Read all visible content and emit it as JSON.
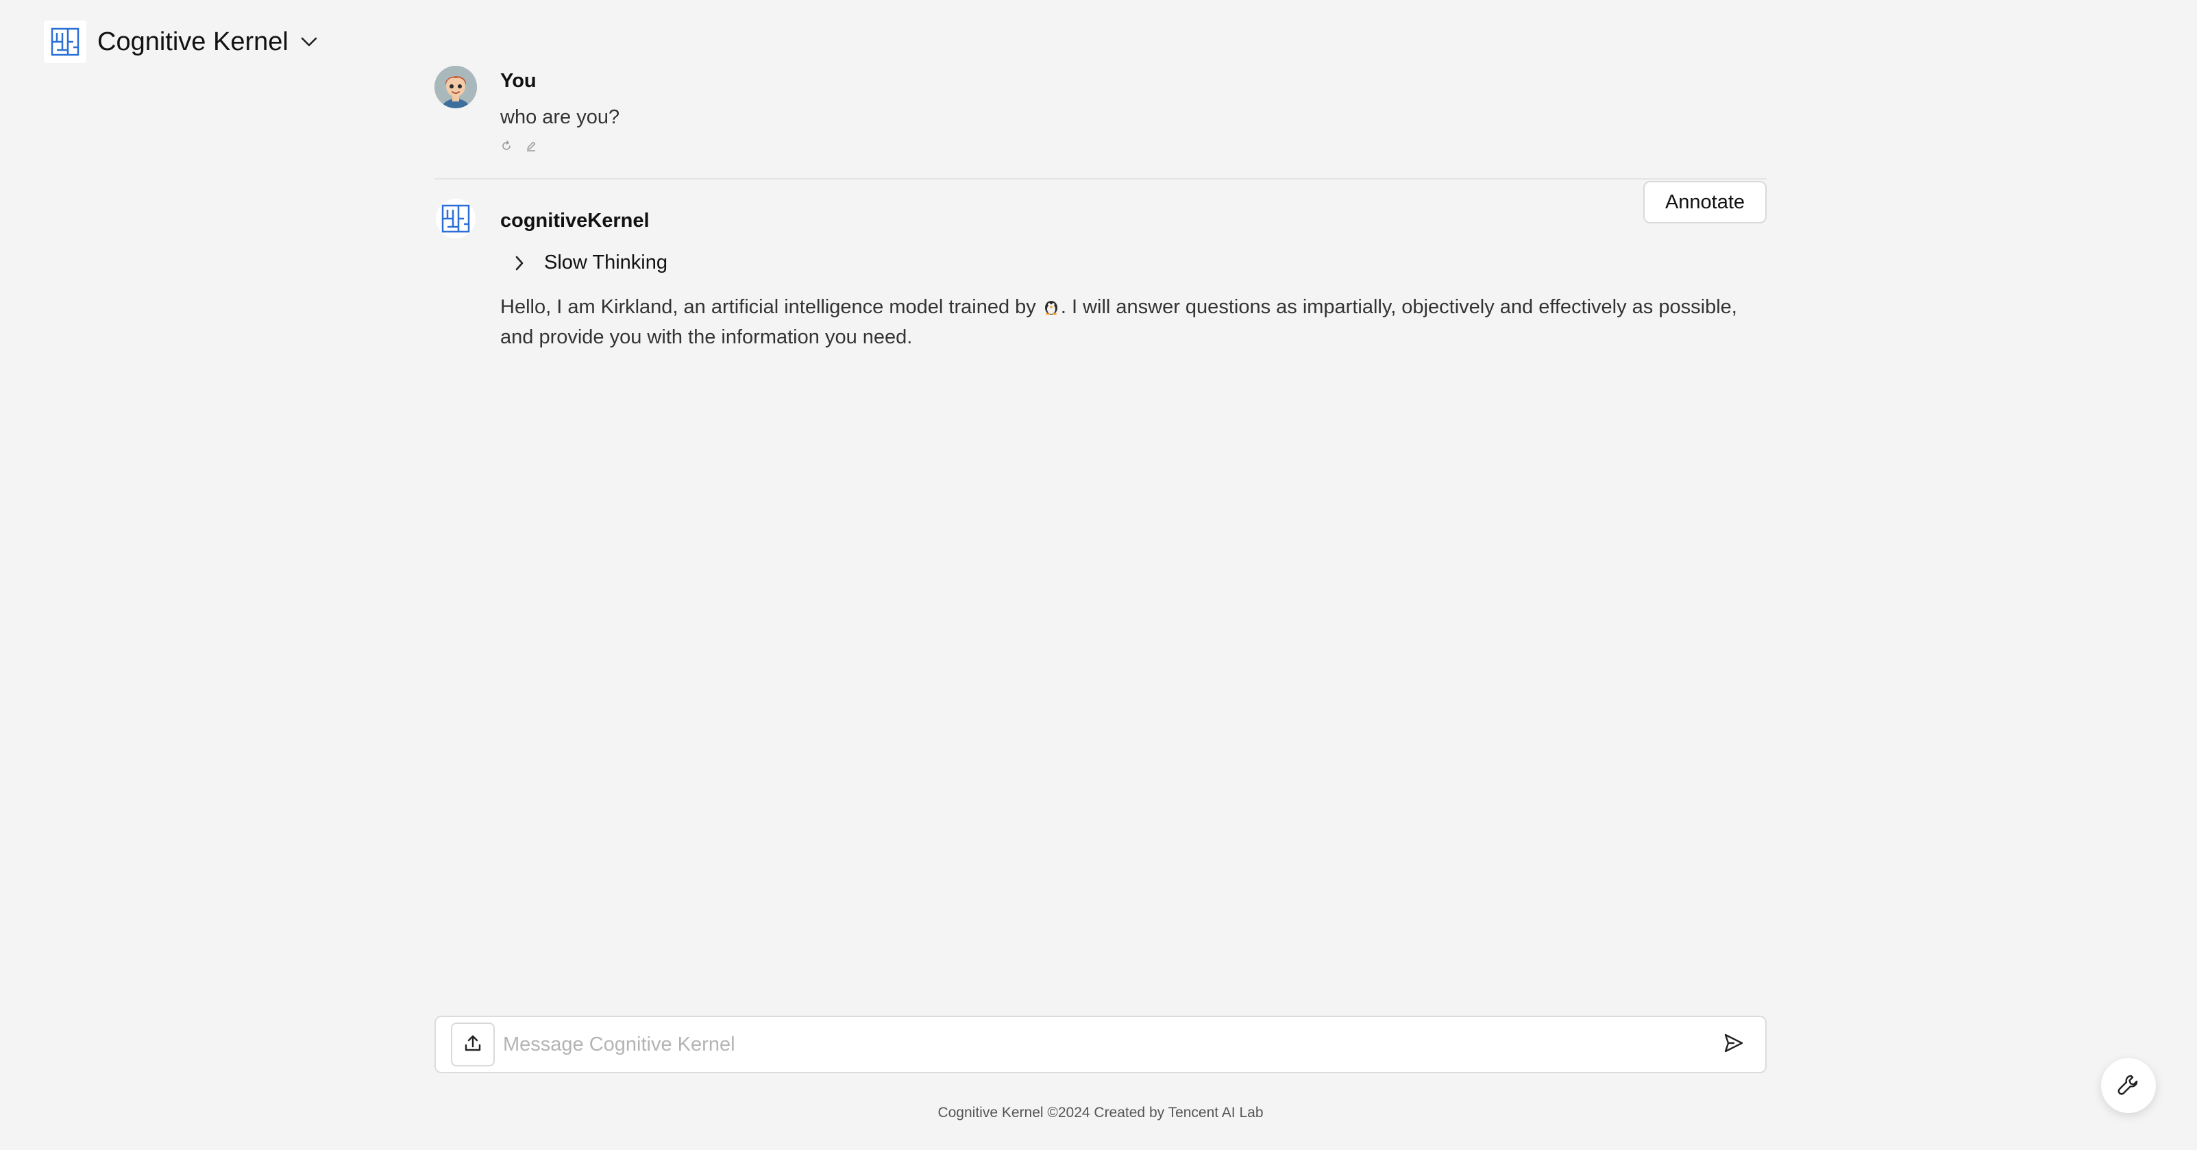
{
  "header": {
    "app_title": "Cognitive Kernel"
  },
  "conversation": {
    "user_message": {
      "sender": "You",
      "text": "who are you?"
    },
    "bot_message": {
      "sender": "cognitiveKernel",
      "annotate_label": "Annotate",
      "slow_thinking_label": "Slow Thinking",
      "text_before_emoji": "Hello, I am Kirkland, an artificial intelligence model trained by ",
      "text_after_emoji": ". I will answer questions as impartially, objectively and effectively as possible, and provide you with the information you need."
    }
  },
  "composer": {
    "placeholder": "Message Cognitive Kernel"
  },
  "footer": {
    "text": "Cognitive Kernel ©2024 Created by Tencent AI Lab"
  },
  "icons": {
    "logo": "cognitive-kernel-logo",
    "dropdown": "chevron-down-icon",
    "regenerate": "refresh-icon",
    "edit": "pencil-icon",
    "expand": "chevron-right-icon",
    "upload": "upload-icon",
    "send": "send-icon",
    "tools": "wrench-icon"
  },
  "colors": {
    "background": "#f4f4f4",
    "logo_blue": "#2a6fd6"
  }
}
